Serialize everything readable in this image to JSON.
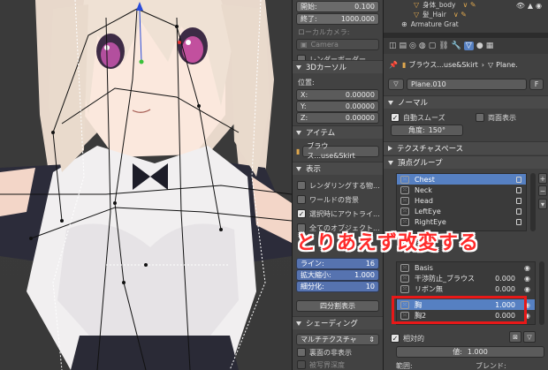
{
  "viewport": {
    "description_icon": "anime-character-3d-model-with-armature"
  },
  "npanel": {
    "start_label": "開始:",
    "start_value": "0.100",
    "end_label": "終了:",
    "end_value": "1000.000",
    "local_camera_label": "ローカルカメラ:",
    "camera_field": "Camera",
    "render_border_label": "レンダーボーダー",
    "cursor_header": "3Dカーソル",
    "location_label": "位置:",
    "x_label": "X:",
    "x_value": "0.00000",
    "y_label": "Y:",
    "y_value": "0.00000",
    "z_label": "Z:",
    "z_value": "0.00000",
    "item_header": "アイテム",
    "item_name": "ブラウス...use&Skirt",
    "display_header": "表示",
    "check_rendering_only": "レンダリングする物...",
    "check_world_bg": "ワールドの背景",
    "check_outline_selected": "選択時にアウトライ...",
    "check_all_objects": "全てのオブジェクト...",
    "lines_label": "ライン:",
    "lines_value": "16",
    "scale_label": "拡大縮小:",
    "scale_value": "1.000",
    "subdiv_label": "細分化:",
    "subdiv_value": "10",
    "quad_view_button": "四分割表示",
    "shading_header": "シェーディング",
    "shading_mode": "マルチテクスチャ",
    "check_texture_solid": "裏面の非表示",
    "check_hidden_wire": "被写界深度"
  },
  "outliner": {
    "rows": [
      {
        "name": "身体_body"
      },
      {
        "name": "髪_Hair"
      },
      {
        "name": "Armature Grat"
      }
    ]
  },
  "properties": {
    "breadcrumb_object": "ブラウス...use&Skirt",
    "breadcrumb_mesh": "Plane.",
    "mesh_name": "Plane.010",
    "mesh_fake": "F",
    "normals_header": "ノーマル",
    "auto_smooth_label": "自動スムーズ",
    "double_sided_label": "両面表示",
    "angle_label": "角度:",
    "angle_value": "150°",
    "texture_space_header": "テクスチャスペース",
    "vertex_groups_header": "頂点グループ",
    "vertex_groups": [
      "Chest",
      "Neck",
      "Head",
      "LeftEye",
      "RightEye"
    ],
    "shape_keys": [
      {
        "name": "Basis",
        "value": ""
      },
      {
        "name": "干渉防止_ブラウス",
        "value": "0.000"
      },
      {
        "name": "リボン無",
        "value": "0.000"
      },
      {
        "name": "胸",
        "value": "1.000"
      },
      {
        "name": "胸2",
        "value": "0.000"
      }
    ],
    "relative_label": "相対的",
    "value_label": "値:",
    "value_value": "1.000",
    "range_label": "範囲:",
    "blend_label": "ブレンド:"
  },
  "annotation": {
    "overlay_text": "とりあえず改変する"
  },
  "colors": {
    "overlay_red": "#ff2a2a",
    "selection_blue": "#5680c2",
    "highlight_box": "#e81818"
  }
}
